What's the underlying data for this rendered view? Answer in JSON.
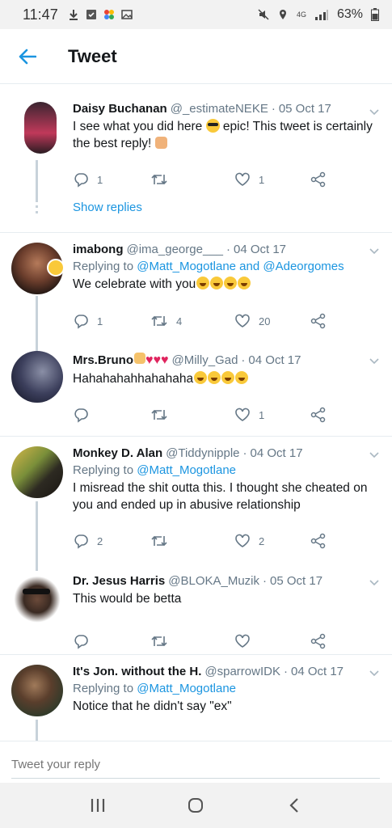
{
  "status_bar": {
    "time": "11:47",
    "network": "4G",
    "battery": "63%"
  },
  "header": {
    "title": "Tweet"
  },
  "tweets": [
    {
      "name": "Daisy Buchanan",
      "handle": "@_estimateNEKE",
      "date": "05 Oct 17",
      "reply_to_prefix": "",
      "reply_to_mentions": "",
      "text_before": "I see what you did here",
      "text_after": "epic! This tweet is certainly the best reply!",
      "replies": "1",
      "retweets": "",
      "likes": "1",
      "show_replies": "Show replies"
    },
    {
      "name": "imabong",
      "handle": "@ima_george___",
      "date": "04 Oct 17",
      "reply_to_prefix": "Replying to",
      "reply_to_mentions": "@Matt_Mogotlane and @Adeorgomes",
      "text": "We celebrate with you",
      "replies": "1",
      "retweets": "4",
      "likes": "20"
    },
    {
      "name": "Mrs.Bruno",
      "handle": "@Milly_Gad",
      "date": "04 Oct 17",
      "text": "Hahahahahhahahaha",
      "replies": "",
      "retweets": "",
      "likes": "1"
    },
    {
      "name": "Monkey D. Alan",
      "handle": "@Tiddynipple",
      "date": "04 Oct 17",
      "reply_to_prefix": "Replying to",
      "reply_to_mentions": "@Matt_Mogotlane",
      "text": "I misread the shit outta this. I thought she cheated on you and ended up in abusive relationship",
      "replies": "2",
      "retweets": "",
      "likes": "2"
    },
    {
      "name": "Dr. Jesus Harris",
      "handle": "@BLOKA_Muzik",
      "date": "05 Oct 17",
      "text": "This would be betta",
      "replies": "",
      "retweets": "",
      "likes": ""
    },
    {
      "name": "It's Jon. without the H.",
      "handle": "@sparrowIDK",
      "date": "04 Oct 17",
      "reply_to_prefix": "Replying to",
      "reply_to_mentions": "@Matt_Mogotlane",
      "text": "Notice that he didn't say \"ex\""
    }
  ],
  "compose": {
    "placeholder": "Tweet your reply"
  },
  "colors": {
    "accent": "#1b95e0",
    "muted": "#657786",
    "thread_line": "#c8d2da"
  }
}
